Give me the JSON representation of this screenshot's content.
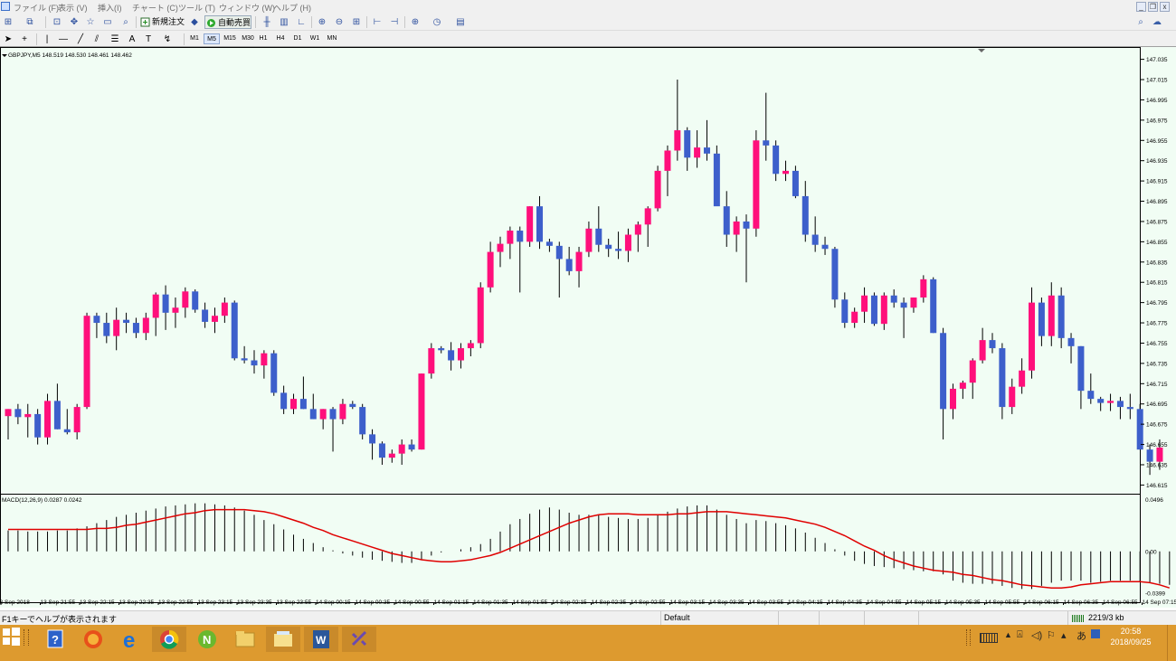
{
  "menu": {
    "items": [
      "ファイル (F)",
      "表示 (V)",
      "挿入(I)",
      "チャート (C)",
      "ツール (T)",
      "ウィンドウ (W)",
      "ヘルプ (H)"
    ]
  },
  "window_controls": {
    "minimize": "_",
    "restore": "❐",
    "close": "x"
  },
  "toolbar": {
    "new_order_label": "新規注文",
    "auto_trade_label": "自動売買",
    "timeframes": [
      "M1",
      "M5",
      "M15",
      "M30",
      "H1",
      "H4",
      "D1",
      "W1",
      "MN"
    ],
    "active_timeframe": "M5"
  },
  "chart": {
    "header": "GBPJPY,M5  148.519 148.530 148.461 148.462",
    "macd_header": "MACD(12,26,9) 0.0287 0.0242",
    "colors": {
      "bull": "#ff0f7b",
      "bear": "#3d5fcb",
      "signal": "#e00000",
      "background": "#f1fdf4"
    }
  },
  "chart_data": {
    "type": "candlestick",
    "symbol": "GBPJPY",
    "timeframe": "M5",
    "price_ticks": [
      "147.035",
      "147.015",
      "146.995",
      "146.975",
      "146.955",
      "146.935",
      "146.915",
      "146.895",
      "146.875",
      "146.855",
      "146.835",
      "146.815",
      "146.795",
      "146.775",
      "146.755",
      "146.735",
      "146.715",
      "146.695",
      "146.675",
      "146.655",
      "146.635",
      "146.615"
    ],
    "ylim": [
      146.61,
      147.04
    ],
    "macd_ticks": [
      "0.0496",
      "0.00",
      "-0.0399"
    ],
    "macd_ylim": [
      -0.04,
      0.05
    ],
    "time_labels": [
      "13 Sep 2018",
      "13 Sep 21:55",
      "13 Sep 22:15",
      "13 Sep 22:35",
      "13 Sep 22:55",
      "13 Sep 23:15",
      "13 Sep 23:35",
      "13 Sep 23:55",
      "14 Sep 00:15",
      "14 Sep 00:35",
      "14 Sep 00:55",
      "14 Sep 01:15",
      "14 Sep 01:35",
      "14 Sep 01:55",
      "14 Sep 02:15",
      "14 Sep 02:35",
      "14 Sep 02:55",
      "14 Sep 03:15",
      "14 Sep 03:35",
      "14 Sep 03:55",
      "14 Sep 04:15",
      "14 Sep 04:35",
      "14 Sep 04:55",
      "14 Sep 05:15",
      "14 Sep 05:35",
      "14 Sep 05:55",
      "14 Sep 06:15",
      "14 Sep 06:35",
      "14 Sep 06:55",
      "14 Sep 07:15"
    ],
    "candles": [
      [
        146.683,
        146.69,
        146.66,
        146.69
      ],
      [
        146.69,
        146.695,
        146.675,
        146.682
      ],
      [
        146.682,
        146.695,
        146.662,
        146.685
      ],
      [
        146.685,
        146.69,
        146.655,
        146.662
      ],
      [
        146.662,
        146.705,
        146.655,
        146.698
      ],
      [
        146.698,
        146.715,
        146.67,
        146.67
      ],
      [
        146.67,
        146.69,
        146.665,
        146.667
      ],
      [
        146.667,
        146.695,
        146.66,
        146.692
      ],
      [
        146.692,
        146.785,
        146.69,
        146.782
      ],
      [
        146.782,
        146.785,
        146.76,
        146.775
      ],
      [
        146.775,
        146.785,
        146.755,
        146.762
      ],
      [
        146.762,
        146.79,
        146.748,
        146.778
      ],
      [
        146.778,
        146.785,
        146.765,
        146.775
      ],
      [
        146.775,
        146.78,
        146.76,
        146.765
      ],
      [
        146.765,
        146.785,
        146.758,
        146.78
      ],
      [
        146.78,
        146.805,
        146.762,
        146.803
      ],
      [
        146.803,
        146.812,
        146.768,
        146.785
      ],
      [
        146.785,
        146.8,
        146.77,
        146.79
      ],
      [
        146.79,
        146.81,
        146.78,
        146.806
      ],
      [
        146.806,
        146.808,
        146.785,
        146.788
      ],
      [
        146.788,
        146.795,
        146.77,
        146.776
      ],
      [
        146.776,
        146.79,
        146.765,
        146.782
      ],
      [
        146.782,
        146.8,
        146.775,
        146.795
      ],
      [
        146.795,
        146.797,
        146.738,
        146.74
      ],
      [
        146.74,
        146.752,
        146.735,
        146.738
      ],
      [
        146.738,
        146.748,
        146.725,
        146.733
      ],
      [
        146.733,
        146.748,
        146.72,
        146.745
      ],
      [
        146.745,
        146.748,
        146.703,
        146.706
      ],
      [
        146.706,
        146.713,
        146.685,
        146.69
      ],
      [
        146.69,
        146.705,
        146.685,
        146.7
      ],
      [
        146.7,
        146.722,
        146.69,
        146.69
      ],
      [
        146.69,
        146.705,
        146.68,
        146.68
      ],
      [
        146.68,
        146.69,
        146.67,
        146.69
      ],
      [
        146.69,
        146.692,
        146.648,
        146.68
      ],
      [
        146.68,
        146.7,
        146.675,
        146.695
      ],
      [
        146.695,
        146.698,
        146.69,
        146.692
      ],
      [
        146.692,
        146.695,
        146.66,
        146.665
      ],
      [
        146.665,
        146.67,
        146.64,
        146.656
      ],
      [
        146.656,
        146.658,
        146.635,
        146.642
      ],
      [
        146.642,
        146.65,
        146.637,
        146.646
      ],
      [
        146.646,
        146.66,
        146.635,
        146.655
      ],
      [
        146.655,
        146.66,
        146.648,
        146.65
      ],
      [
        146.65,
        146.725,
        146.65,
        146.725
      ],
      [
        146.725,
        146.755,
        146.72,
        146.75
      ],
      [
        146.75,
        146.752,
        146.745,
        146.748
      ],
      [
        146.748,
        146.756,
        146.728,
        146.738
      ],
      [
        146.738,
        146.755,
        146.73,
        146.75
      ],
      [
        146.75,
        146.758,
        146.742,
        146.755
      ],
      [
        146.755,
        146.815,
        146.75,
        146.81
      ],
      [
        146.81,
        146.855,
        146.805,
        146.845
      ],
      [
        146.845,
        146.86,
        146.83,
        146.853
      ],
      [
        146.853,
        146.87,
        146.838,
        146.866
      ],
      [
        146.866,
        146.87,
        146.805,
        146.855
      ],
      [
        146.855,
        146.89,
        146.85,
        146.89
      ],
      [
        146.89,
        146.9,
        146.848,
        146.855
      ],
      [
        146.855,
        146.858,
        146.845,
        146.851
      ],
      [
        146.851,
        146.855,
        146.8,
        146.838
      ],
      [
        146.838,
        146.85,
        146.822,
        146.826
      ],
      [
        146.826,
        146.85,
        146.81,
        146.845
      ],
      [
        146.845,
        146.875,
        146.84,
        146.868
      ],
      [
        146.868,
        146.89,
        146.845,
        146.852
      ],
      [
        146.852,
        146.858,
        146.84,
        146.848
      ],
      [
        146.848,
        146.865,
        146.838,
        146.846
      ],
      [
        146.846,
        146.868,
        146.835,
        146.862
      ],
      [
        146.862,
        146.875,
        146.845,
        146.872
      ],
      [
        146.872,
        146.89,
        146.85,
        146.888
      ],
      [
        146.888,
        146.93,
        146.885,
        146.925
      ],
      [
        146.925,
        146.95,
        146.9,
        146.945
      ],
      [
        146.945,
        147.015,
        146.935,
        146.965
      ],
      [
        146.965,
        146.968,
        146.925,
        146.938
      ],
      [
        146.938,
        146.965,
        146.928,
        146.948
      ],
      [
        146.948,
        146.975,
        146.935,
        146.942
      ],
      [
        146.942,
        146.95,
        146.9,
        146.89
      ],
      [
        146.89,
        146.905,
        146.85,
        146.862
      ],
      [
        146.862,
        146.88,
        146.845,
        146.875
      ],
      [
        146.875,
        146.882,
        146.815,
        146.868
      ],
      [
        146.868,
        146.965,
        146.86,
        146.955
      ],
      [
        146.955,
        147.002,
        146.935,
        146.95
      ],
      [
        146.95,
        146.955,
        146.915,
        146.922
      ],
      [
        146.922,
        146.935,
        146.915,
        146.925
      ],
      [
        146.925,
        146.93,
        146.898,
        146.9
      ],
      [
        146.9,
        146.915,
        146.855,
        146.862
      ],
      [
        146.862,
        146.88,
        146.845,
        146.852
      ],
      [
        146.852,
        146.86,
        146.842,
        146.848
      ],
      [
        146.848,
        146.85,
        146.79,
        146.798
      ],
      [
        146.798,
        146.805,
        146.77,
        146.775
      ],
      [
        146.775,
        146.79,
        146.77,
        146.786
      ],
      [
        146.786,
        146.81,
        146.775,
        146.802
      ],
      [
        146.802,
        146.805,
        146.772,
        146.774
      ],
      [
        146.774,
        146.805,
        146.768,
        146.802
      ],
      [
        146.802,
        146.808,
        146.79,
        146.795
      ],
      [
        146.795,
        146.8,
        146.76,
        146.79
      ],
      [
        146.79,
        146.8,
        146.785,
        146.8
      ],
      [
        146.8,
        146.822,
        146.795,
        146.818
      ],
      [
        146.818,
        146.82,
        146.765,
        146.765
      ],
      [
        146.765,
        146.77,
        146.66,
        146.69
      ],
      [
        146.69,
        146.715,
        146.68,
        146.71
      ],
      [
        146.71,
        146.718,
        146.7,
        146.716
      ],
      [
        146.716,
        146.74,
        146.7,
        146.738
      ],
      [
        146.738,
        146.77,
        146.735,
        146.758
      ],
      [
        146.758,
        146.765,
        146.745,
        146.75
      ],
      [
        146.75,
        146.755,
        146.68,
        146.692
      ],
      [
        146.692,
        146.72,
        146.685,
        146.712
      ],
      [
        146.712,
        146.74,
        146.705,
        146.728
      ],
      [
        146.728,
        146.81,
        146.72,
        146.795
      ],
      [
        146.795,
        146.8,
        146.752,
        146.762
      ],
      [
        146.762,
        146.815,
        146.752,
        146.802
      ],
      [
        146.802,
        146.81,
        146.75,
        146.76
      ],
      [
        146.76,
        146.765,
        146.735,
        146.752
      ],
      [
        146.752,
        146.752,
        146.69,
        146.708
      ],
      [
        146.708,
        146.725,
        146.695,
        146.7
      ],
      [
        146.7,
        146.702,
        146.688,
        146.696
      ],
      [
        146.696,
        146.705,
        146.688,
        146.698
      ],
      [
        146.698,
        146.702,
        146.68,
        146.692
      ],
      [
        146.692,
        146.705,
        146.68,
        146.69
      ],
      [
        146.69,
        146.695,
        146.65,
        146.65
      ],
      [
        146.65,
        146.655,
        146.625,
        146.638
      ],
      [
        146.638,
        146.66,
        146.63,
        146.652
      ]
    ],
    "macd_histogram": [
      0.02,
      0.02,
      0.019,
      0.019,
      0.019,
      0.02,
      0.02,
      0.022,
      0.024,
      0.027,
      0.03,
      0.033,
      0.035,
      0.037,
      0.039,
      0.041,
      0.043,
      0.044,
      0.045,
      0.046,
      0.046,
      0.045,
      0.044,
      0.042,
      0.039,
      0.035,
      0.03,
      0.026,
      0.021,
      0.016,
      0.012,
      0.008,
      0.004,
      0.001,
      -0.002,
      -0.004,
      -0.006,
      -0.008,
      -0.009,
      -0.01,
      -0.011,
      -0.011,
      -0.008,
      -0.004,
      -0.001,
      0.0,
      0.002,
      0.004,
      0.007,
      0.012,
      0.019,
      0.026,
      0.031,
      0.036,
      0.04,
      0.042,
      0.04,
      0.037,
      0.035,
      0.035,
      0.035,
      0.033,
      0.032,
      0.031,
      0.031,
      0.032,
      0.035,
      0.038,
      0.041,
      0.043,
      0.044,
      0.044,
      0.04,
      0.035,
      0.031,
      0.027,
      0.03,
      0.029,
      0.027,
      0.025,
      0.022,
      0.018,
      0.013,
      0.008,
      0.002,
      -0.004,
      -0.009,
      -0.012,
      -0.014,
      -0.015,
      -0.016,
      -0.017,
      -0.018,
      -0.019,
      -0.019,
      -0.022,
      -0.028,
      -0.03,
      -0.031,
      -0.031,
      -0.031,
      -0.033,
      -0.035,
      -0.036,
      -0.036,
      -0.033,
      -0.03,
      -0.028,
      -0.028,
      -0.028,
      -0.03,
      -0.029,
      -0.028,
      -0.028,
      -0.028,
      -0.029,
      -0.03,
      -0.031,
      -0.032
    ],
    "macd_signal": [
      0.021,
      0.021,
      0.021,
      0.021,
      0.021,
      0.021,
      0.021,
      0.021,
      0.021,
      0.022,
      0.022,
      0.023,
      0.025,
      0.026,
      0.028,
      0.03,
      0.032,
      0.034,
      0.036,
      0.037,
      0.039,
      0.04,
      0.04,
      0.04,
      0.04,
      0.039,
      0.038,
      0.036,
      0.033,
      0.03,
      0.027,
      0.023,
      0.02,
      0.016,
      0.013,
      0.01,
      0.007,
      0.004,
      0.001,
      -0.002,
      -0.004,
      -0.006,
      -0.008,
      -0.009,
      -0.01,
      -0.01,
      -0.009,
      -0.008,
      -0.006,
      -0.004,
      -0.001,
      0.003,
      0.007,
      0.011,
      0.015,
      0.019,
      0.023,
      0.027,
      0.03,
      0.033,
      0.035,
      0.036,
      0.036,
      0.036,
      0.035,
      0.035,
      0.035,
      0.035,
      0.036,
      0.036,
      0.037,
      0.038,
      0.038,
      0.038,
      0.037,
      0.036,
      0.035,
      0.034,
      0.033,
      0.032,
      0.03,
      0.028,
      0.026,
      0.023,
      0.019,
      0.015,
      0.01,
      0.005,
      0.001,
      -0.004,
      -0.008,
      -0.011,
      -0.014,
      -0.016,
      -0.018,
      -0.019,
      -0.02,
      -0.022,
      -0.023,
      -0.025,
      -0.027,
      -0.028,
      -0.03,
      -0.032,
      -0.033,
      -0.034,
      -0.035,
      -0.035,
      -0.034,
      -0.032,
      -0.031,
      -0.03,
      -0.029,
      -0.029,
      -0.029,
      -0.029,
      -0.03,
      -0.032,
      -0.035
    ]
  },
  "status": {
    "help_text": "F1キーでヘルプが表示されます",
    "profile": "Default",
    "traffic": "2219/3 kb"
  },
  "taskbar": {
    "apps": [
      "help-icon",
      "firefox-icon",
      "ie-icon",
      "chrome-icon",
      "nchart-icon",
      "explorer-icon",
      "folder-icon",
      "word-icon",
      "mt4-icon"
    ],
    "tray": {
      "time": "20:58",
      "date": "2018/09/25"
    }
  }
}
